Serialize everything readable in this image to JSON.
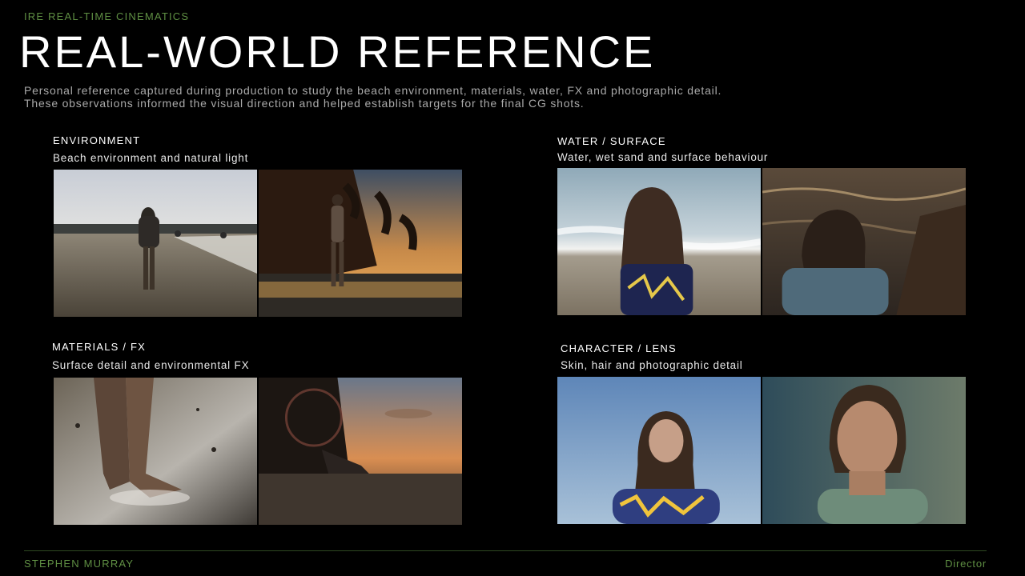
{
  "header": {
    "kicker": "IRE REAL-TIME CINEMATICS",
    "title": "REAL-WORLD REFERENCE",
    "intro": "Personal reference captured during production to study the beach environment, materials, water, FX and photographic detail. These observations informed the visual direction and helped establish targets for the final CG shots."
  },
  "sections": [
    {
      "title": "ENVIRONMENT",
      "subtitle": "Beach environment and natural light"
    },
    {
      "title": "WATER / SURFACE",
      "subtitle": "Water, wet sand and surface behaviour"
    },
    {
      "title": "MATERIALS / FX",
      "subtitle": "Surface detail and environmental FX"
    },
    {
      "title": "CHARACTER / LENS",
      "subtitle": "Skin, hair and photographic detail"
    }
  ],
  "footer": {
    "name": "STEPHEN MURRAY",
    "role": "Director"
  },
  "colors": {
    "accent": "#5f8f43",
    "background": "#000000"
  }
}
